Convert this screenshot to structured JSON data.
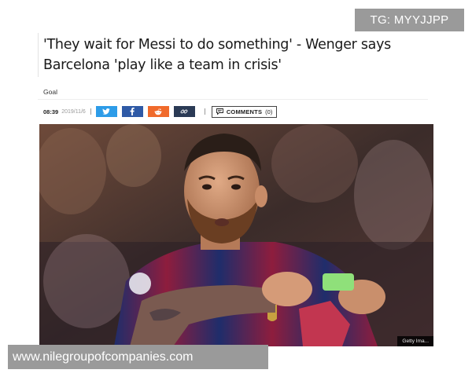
{
  "article": {
    "headline": "'They wait for Messi to do something' - Wenger says Barcelona 'play like a team in crisis'",
    "source": "Goal",
    "time": "08:39",
    "date": "2019/11/6",
    "share_buttons": [
      {
        "name": "twitter",
        "icon": "twitter-bird-icon",
        "color": "#2d9ce8"
      },
      {
        "name": "facebook",
        "icon": "facebook-f-icon",
        "color": "#2f5aa6"
      },
      {
        "name": "reddit",
        "icon": "reddit-alien-icon",
        "color": "#f06a2b"
      },
      {
        "name": "link",
        "icon": "link-chain-icon",
        "color": "#2a3a55"
      }
    ],
    "comments_label": "COMMENTS",
    "comments_count": "(0)",
    "photo_credit": "Getty Ima..."
  },
  "watermarks": {
    "top": "TG: MYYJJPP",
    "bottom": "www.nilegroupofcompanies.com"
  }
}
